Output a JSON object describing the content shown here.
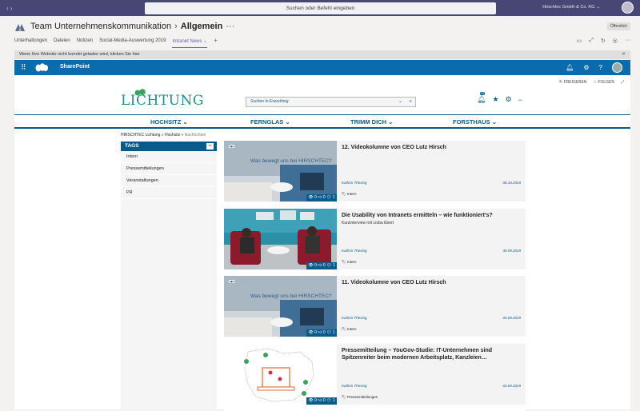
{
  "topbar": {
    "search_placeholder": "Suchen oder Befehl eingeben",
    "org_name": "Hirschtec GmbH & Co. KG"
  },
  "team": {
    "name": "Team Unternehmenskommunikation",
    "channel": "Allgemein",
    "visibility": "Öffentlich",
    "tabs": [
      "Unterhaltungen",
      "Dateien",
      "Notizen",
      "Social-Media-Auswertung 2019",
      "Intranet News"
    ]
  },
  "notice": "Wenn Ihre Website nicht korrekt geladen wird, klicken Sie hier",
  "sharepoint": {
    "name": "SharePoint",
    "share_label": "FREIGEBEN",
    "follow_label": "FOLGEN"
  },
  "site": {
    "logo_text": "LICHTUNG",
    "search_placeholder": "Suchen In Everything",
    "bell_count": "10",
    "nav": [
      "HOCHSITZ",
      "FERNGLAS",
      "TRIMM DICH",
      "FORSTHAUS"
    ],
    "breadcrumb": {
      "root": "HIRSCHTEC Lichtung",
      "middle": "Hochsitz",
      "current": "Nachrichten",
      "separator": "»"
    }
  },
  "tags": {
    "title": "TAGS",
    "items": [
      "Intern",
      "Pressemitteilungen",
      "Veranstaltungen",
      "PR"
    ]
  },
  "news": [
    {
      "title": "12. Videokolumne von CEO Lutz Hirsch",
      "subtitle": "",
      "author": "Kathrin Thesing",
      "date": "08.10.2019",
      "tag": "Intern",
      "thumb_text": "Was bewegt uns bei HIRSCHTEC?",
      "views": "0",
      "likes": "0",
      "comments": "1"
    },
    {
      "title": "Die Usability von Intranets ermitteln – wie funktioniert's?",
      "subtitle": "Kurzinterview mit Lioba Ebert",
      "author": "Kathrin Thesing",
      "date": "30.09.2019",
      "tag": "Intern",
      "thumb_text": "",
      "views": "0",
      "likes": "0",
      "comments": "1"
    },
    {
      "title": "11. Videokolumne von CEO Lutz Hirsch",
      "subtitle": "",
      "author": "Kathrin Thesing",
      "date": "05.09.2019",
      "tag": "Intern",
      "thumb_text": "Was bewegt uns bei HIRSCHTEC?",
      "views": "0",
      "likes": "0",
      "comments": "1"
    },
    {
      "title": "Pressemitteilung – YouGov-Studie: IT-Unternehmen sind Spitzenreiter beim modernen Arbeitsplatz, Kanzleien…",
      "subtitle": "",
      "author": "Kathrin Thesing",
      "date": "03.09.2019",
      "tag": "Pressemitteilungen",
      "thumb_text": "",
      "views": "0",
      "likes": "0",
      "comments": "1"
    }
  ]
}
